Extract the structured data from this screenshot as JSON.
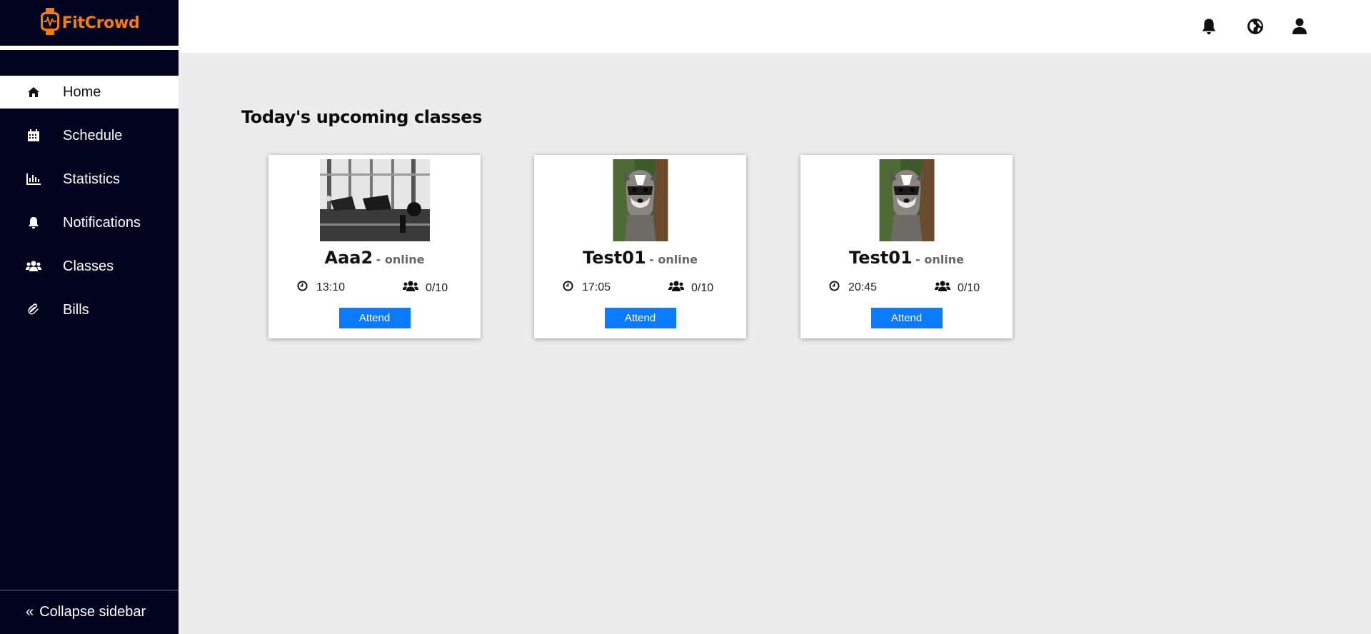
{
  "brand": {
    "name": "FitCrowd",
    "accent": "#f47b0f",
    "sidebar_bg": "#02031f",
    "button_color": "#0a7bff"
  },
  "sidebar": {
    "items": [
      {
        "label": "Home",
        "icon": "home-icon",
        "active": true
      },
      {
        "label": "Schedule",
        "icon": "calendar-icon",
        "active": false
      },
      {
        "label": "Statistics",
        "icon": "bar-chart-icon",
        "active": false
      },
      {
        "label": "Notifications",
        "icon": "bell-icon",
        "active": false
      },
      {
        "label": "Classes",
        "icon": "users-icon",
        "active": false
      },
      {
        "label": "Bills",
        "icon": "paperclip-icon",
        "active": false
      }
    ],
    "collapse_label": "Collapse sidebar"
  },
  "header": {
    "icons": [
      "bell-icon",
      "globe-icon",
      "user-icon"
    ]
  },
  "main": {
    "title": "Today's upcoming classes",
    "cards": [
      {
        "name": "Aaa2",
        "mode": "- online",
        "time": "13:10",
        "capacity": "0/10",
        "button": "Attend",
        "image": "gym-photo"
      },
      {
        "name": "Test01",
        "mode": "- online",
        "time": "17:05",
        "capacity": "0/10",
        "button": "Attend",
        "image": "raccoon-photo"
      },
      {
        "name": "Test01",
        "mode": "- online",
        "time": "20:45",
        "capacity": "0/10",
        "button": "Attend",
        "image": "raccoon-photo"
      }
    ]
  }
}
